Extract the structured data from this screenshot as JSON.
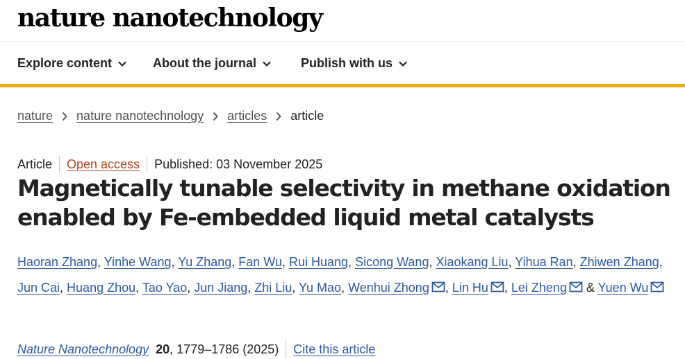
{
  "brand": {
    "name": "nature nanotechnology"
  },
  "nav": {
    "items": [
      {
        "label": "Explore content"
      },
      {
        "label": "About the journal"
      },
      {
        "label": "Publish with us"
      }
    ]
  },
  "breadcrumb": {
    "items": [
      {
        "label": "nature"
      },
      {
        "label": "nature nanotechnology"
      },
      {
        "label": "articles"
      },
      {
        "label": "article"
      }
    ]
  },
  "article": {
    "type": "Article",
    "access": "Open access",
    "published": "Published: 03 November 2025",
    "title": "Magnetically tunable selectivity in methane oxidation enabled by Fe-embedded liquid metal catalysts",
    "authors": [
      {
        "name": "Haoran Zhang",
        "sep": ", "
      },
      {
        "name": "Yinhe Wang",
        "sep": ", "
      },
      {
        "name": "Yu Zhang",
        "sep": ", "
      },
      {
        "name": "Fan Wu",
        "sep": ", "
      },
      {
        "name": "Rui Huang",
        "sep": ", "
      },
      {
        "name": "Sicong Wang",
        "sep": ", "
      },
      {
        "name": "Xiaokang Liu",
        "sep": ", "
      },
      {
        "name": "Yihua Ran",
        "sep": ", "
      },
      {
        "name": "Zhiwen Zhang",
        "sep": ", "
      },
      {
        "name": "Jun Cai",
        "sep": ", "
      },
      {
        "name": "Huang Zhou",
        "sep": ", "
      },
      {
        "name": "Tao Yao",
        "sep": ", "
      },
      {
        "name": "Jun Jiang",
        "sep": ", "
      },
      {
        "name": "Zhi Liu",
        "sep": ", "
      },
      {
        "name": "Yu Mao",
        "sep": ", "
      },
      {
        "name": "Wenhui Zhong",
        "sep": ", ",
        "mail": true
      },
      {
        "name": "Lin Hu",
        "sep": ", ",
        "mail": true
      },
      {
        "name": "Lei Zheng",
        "sep": " ",
        "mail": true
      },
      {
        "prefix": "& ",
        "name": "Yuen Wu",
        "sep": "",
        "mail": true
      }
    ]
  },
  "citation": {
    "journal": "Nature Nanotechnology",
    "volume": "20",
    "rest": ", 1779–1786 (2025)",
    "cite_label": "Cite this article"
  },
  "colors": {
    "accent_bar": "#f0a800",
    "link": "#2b5aa3",
    "open_access": "#b1461d",
    "text": "#222222"
  },
  "icons": {
    "nav_chevron": "chevron-down-icon",
    "breadcrumb_separator": "chevron-right-icon",
    "author_mail": "envelope-icon"
  }
}
